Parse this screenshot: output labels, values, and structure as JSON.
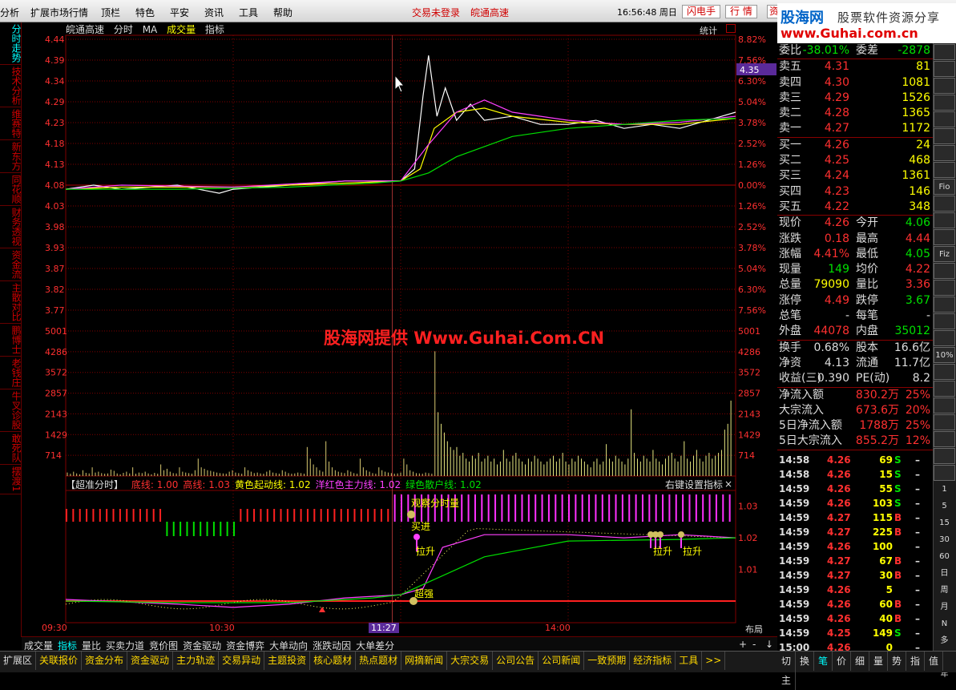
{
  "menu": {
    "items": [
      "分析",
      "扩展市场行情",
      "顶栏",
      "特色",
      "平安",
      "资讯",
      "工具",
      "帮助"
    ],
    "trade_status": "交易未登录",
    "stock_name": "皖通高速",
    "clock": "16:56:48 周日",
    "btn_flash": "闪电手",
    "btn_quote": "行 情",
    "btn_info": "资"
  },
  "logo": {
    "line1": "股海网",
    "line2": "股票软件资源分享",
    "line3": "www.Guhai.com.cn"
  },
  "left_tabs": [
    "分时走势",
    "技术分析",
    "维赛特",
    "新东方",
    "同花顺",
    "财务透视",
    "资金流",
    "主散对比",
    "鹏博士",
    "老钱庄",
    "牛叉诊股",
    "敢死队",
    "摆渡1"
  ],
  "chart_header": {
    "stock": "皖通高速",
    "items": [
      "分时",
      "MA",
      "成交量",
      "指标"
    ],
    "stats": "统计"
  },
  "price_axis": {
    "left": [
      "4.44",
      "4.39",
      "4.34",
      "4.29",
      "4.23",
      "4.18",
      "4.13",
      "4.08",
      "4.03",
      "3.98",
      "3.93",
      "3.87",
      "3.82",
      "3.77"
    ],
    "right": [
      "8.82%",
      "7.56%",
      "6.30%",
      "5.04%",
      "3.78%",
      "2.52%",
      "1.26%",
      "0.00%",
      "1.26%",
      "2.52%",
      "3.78%",
      "5.04%",
      "6.30%",
      "7.56%"
    ],
    "current_tag": "4.35"
  },
  "volume_axis": [
    "5001",
    "4286",
    "3572",
    "2857",
    "2143",
    "1429",
    "714"
  ],
  "indicator": {
    "title": "【超准分时】",
    "params": [
      {
        "label": "底线: 1.00",
        "color": "#ff3030"
      },
      {
        "label": "高线: 1.03",
        "color": "#ff3030"
      },
      {
        "label": "黄色起动线: 1.02",
        "color": "#ffff00"
      },
      {
        "label": "洋红色主力线: 1.02",
        "color": "#ff40ff"
      },
      {
        "label": "绿色散户线: 1.02",
        "color": "#00e000"
      }
    ],
    "settings": "右键设置指标",
    "close": "×",
    "axis": [
      "1.03",
      "1.02",
      "1.01"
    ],
    "labels": {
      "watch": "观察分时量",
      "buy": "买进",
      "lift": "拉升",
      "strong": "超强",
      "lift2": "拉升",
      "lift3": "拉升"
    }
  },
  "watermark": "股海网提供 Www.Guhai.Com.CN",
  "time_axis": {
    "t0": "09:30",
    "t1": "10:30",
    "t2": "11:27",
    "t3": "14:00",
    "layout": "布局"
  },
  "bottom_tabs": [
    "成交量",
    "指标",
    "量比",
    "买卖力道",
    "竞价图",
    "资金驱动",
    "资金博弈",
    "大单动向",
    "涨跌动因",
    "大单差分"
  ],
  "bottom_tabs_active": 1,
  "bottom_controls": [
    "+",
    "-",
    "↓"
  ],
  "status_tabs": [
    "扩展区",
    "关联报价",
    "资金分布",
    "资金驱动",
    "主力轨迹",
    "交易异动",
    "主题投资",
    "核心题材",
    "热点题材",
    "网摘新闻",
    "大宗交易",
    "公司公告",
    "公司新闻",
    "一致预期",
    "经济指标",
    "工具",
    ">>"
  ],
  "right_bottom_tabs": [
    "切",
    "换",
    "笔",
    "价",
    "细",
    "量",
    "势",
    "指",
    "值",
    "主"
  ],
  "order_book": {
    "weibi_label": "委比",
    "weibi": "-38.01%",
    "weicha_label": "委差",
    "weicha": "-2878",
    "asks": [
      {
        "label": "卖五",
        "price": "4.31",
        "vol": "81"
      },
      {
        "label": "卖四",
        "price": "4.30",
        "vol": "1081"
      },
      {
        "label": "卖三",
        "price": "4.29",
        "vol": "1526"
      },
      {
        "label": "卖二",
        "price": "4.28",
        "vol": "1365"
      },
      {
        "label": "卖一",
        "price": "4.27",
        "vol": "1172"
      }
    ],
    "bids": [
      {
        "label": "买一",
        "price": "4.26",
        "vol": "24"
      },
      {
        "label": "买二",
        "price": "4.25",
        "vol": "468"
      },
      {
        "label": "买三",
        "price": "4.24",
        "vol": "1361"
      },
      {
        "label": "买四",
        "price": "4.23",
        "vol": "146"
      },
      {
        "label": "买五",
        "price": "4.22",
        "vol": "348"
      }
    ]
  },
  "quote": [
    {
      "l1": "现价",
      "v1": "4.26",
      "c1": "red",
      "l2": "今开",
      "v2": "4.06",
      "c2": "green"
    },
    {
      "l1": "涨跌",
      "v1": "0.18",
      "c1": "red",
      "l2": "最高",
      "v2": "4.44",
      "c2": "red"
    },
    {
      "l1": "涨幅",
      "v1": "4.41%",
      "c1": "red",
      "l2": "最低",
      "v2": "4.05",
      "c2": "green"
    },
    {
      "l1": "现量",
      "v1": "149",
      "c1": "green",
      "l2": "均价",
      "v2": "4.22",
      "c2": "red"
    },
    {
      "l1": "总量",
      "v1": "79090",
      "c1": "yellow",
      "l2": "量比",
      "v2": "3.36",
      "c2": "red"
    },
    {
      "l1": "涨停",
      "v1": "4.49",
      "c1": "red",
      "l2": "跌停",
      "v2": "3.67",
      "c2": "green"
    },
    {
      "l1": "总笔",
      "v1": "-",
      "c1": "white",
      "l2": "每笔",
      "v2": "-",
      "c2": "white"
    },
    {
      "l1": "外盘",
      "v1": "44078",
      "c1": "red",
      "l2": "内盘",
      "v2": "35012",
      "c2": "green"
    }
  ],
  "quote2": [
    {
      "l1": "换手",
      "v1": "0.68%",
      "c1": "white",
      "l2": "股本",
      "v2": "16.6亿",
      "c2": "white"
    },
    {
      "l1": "净资",
      "v1": "4.13",
      "c1": "white",
      "l2": "流通",
      "v2": "11.7亿",
      "c2": "white"
    },
    {
      "l1": "收益(三)",
      "v1": "0.390",
      "c1": "white",
      "l2": "PE(动)",
      "v2": "8.2",
      "c2": "white"
    }
  ],
  "flows": [
    {
      "label": "净流入额",
      "value": "830.2万",
      "pct": "25%"
    },
    {
      "label": "大宗流入",
      "value": "673.6万",
      "pct": "20%"
    },
    {
      "label": "5日净流入额",
      "value": "1788万",
      "pct": "25%"
    },
    {
      "label": "5日大宗流入",
      "value": "855.2万",
      "pct": "12%"
    }
  ],
  "ticks": [
    {
      "t": "14:58",
      "p": "4.26",
      "v": "69",
      "bs": "S"
    },
    {
      "t": "14:58",
      "p": "4.26",
      "v": "15",
      "bs": "S"
    },
    {
      "t": "14:59",
      "p": "4.26",
      "v": "55",
      "bs": "S"
    },
    {
      "t": "14:59",
      "p": "4.26",
      "v": "103",
      "bs": "S"
    },
    {
      "t": "14:59",
      "p": "4.27",
      "v": "115",
      "bs": "B"
    },
    {
      "t": "14:59",
      "p": "4.27",
      "v": "225",
      "bs": "B"
    },
    {
      "t": "14:59",
      "p": "4.26",
      "v": "100",
      "bs": ""
    },
    {
      "t": "14:59",
      "p": "4.27",
      "v": "67",
      "bs": "B"
    },
    {
      "t": "14:59",
      "p": "4.27",
      "v": "30",
      "bs": "B"
    },
    {
      "t": "14:59",
      "p": "4.26",
      "v": "5",
      "bs": ""
    },
    {
      "t": "14:59",
      "p": "4.26",
      "v": "60",
      "bs": "B"
    },
    {
      "t": "14:59",
      "p": "4.26",
      "v": "40",
      "bs": "B"
    },
    {
      "t": "14:59",
      "p": "4.25",
      "v": "149",
      "bs": "S"
    },
    {
      "t": "15:00",
      "p": "4.26",
      "v": "0",
      "bs": ""
    }
  ],
  "side_buttons": [
    "",
    "",
    "",
    "",
    "",
    "",
    "",
    "",
    "Fio",
    "",
    "",
    "",
    "Fiz",
    "",
    "",
    "",
    "",
    "",
    "10%",
    "",
    "",
    "",
    "",
    "",
    "",
    "",
    "1",
    "5",
    "15",
    "30",
    "60",
    "日",
    "周",
    "月",
    "N",
    "多",
    "季",
    "年"
  ],
  "colors": {
    "up": "#ff3030",
    "down": "#00e000",
    "volume": "#ffff00",
    "magenta": "#ff40ff",
    "grid": "#800000"
  },
  "chart_data": {
    "type": "line",
    "x_range": [
      "09:30",
      "15:00"
    ],
    "price_ylim": [
      3.72,
      4.44
    ],
    "prev_close": 4.08,
    "series": [
      {
        "points": [
          [
            0,
            4.07
          ],
          [
            10,
            4.08
          ],
          [
            20,
            4.07
          ],
          [
            40,
            4.08
          ],
          [
            55,
            4.06
          ],
          [
            60,
            4.07
          ],
          [
            80,
            4.08
          ],
          [
            100,
            4.09
          ],
          [
            120,
            4.09
          ],
          [
            125,
            4.12
          ],
          [
            128,
            4.3
          ],
          [
            130,
            4.4
          ],
          [
            133,
            4.25
          ],
          [
            136,
            4.32
          ],
          [
            140,
            4.24
          ],
          [
            145,
            4.28
          ],
          [
            150,
            4.24
          ],
          [
            160,
            4.25
          ],
          [
            170,
            4.23
          ],
          [
            180,
            4.23
          ],
          [
            190,
            4.24
          ],
          [
            200,
            4.22
          ],
          [
            210,
            4.23
          ],
          [
            220,
            4.22
          ],
          [
            230,
            4.24
          ],
          [
            235,
            4.25
          ],
          [
            240,
            4.26
          ]
        ],
        "color": "#ffffff"
      },
      {
        "points": [
          [
            0,
            4.07
          ],
          [
            20,
            4.075
          ],
          [
            60,
            4.075
          ],
          [
            100,
            4.085
          ],
          [
            120,
            4.09
          ],
          [
            127,
            4.12
          ],
          [
            132,
            4.22
          ],
          [
            140,
            4.26
          ],
          [
            150,
            4.27
          ],
          [
            160,
            4.25
          ],
          [
            180,
            4.235
          ],
          [
            200,
            4.23
          ],
          [
            220,
            4.23
          ],
          [
            240,
            4.245
          ]
        ],
        "color": "#ffff00"
      },
      {
        "points": [
          [
            0,
            4.07
          ],
          [
            20,
            4.08
          ],
          [
            60,
            4.075
          ],
          [
            100,
            4.09
          ],
          [
            120,
            4.09
          ],
          [
            130,
            4.18
          ],
          [
            140,
            4.26
          ],
          [
            150,
            4.29
          ],
          [
            160,
            4.26
          ],
          [
            180,
            4.24
          ],
          [
            200,
            4.23
          ],
          [
            220,
            4.235
          ],
          [
            240,
            4.25
          ]
        ],
        "color": "#ff40ff"
      },
      {
        "points": [
          [
            0,
            4.07
          ],
          [
            40,
            4.07
          ],
          [
            80,
            4.075
          ],
          [
            110,
            4.085
          ],
          [
            120,
            4.09
          ],
          [
            130,
            4.11
          ],
          [
            140,
            4.15
          ],
          [
            160,
            4.2
          ],
          [
            180,
            4.22
          ],
          [
            200,
            4.23
          ],
          [
            220,
            4.24
          ],
          [
            240,
            4.245
          ]
        ],
        "color": "#00e000"
      }
    ],
    "volume_ylim": [
      0,
      5001
    ],
    "volume": [
      120,
      80,
      150,
      90,
      60,
      200,
      110,
      90,
      300,
      120,
      150,
      100,
      80,
      90,
      220,
      180,
      90,
      60,
      110,
      150,
      90,
      300,
      80,
      120,
      100,
      150,
      90,
      60,
      110,
      80,
      400,
      200,
      250,
      150,
      100,
      90,
      300,
      150,
      120,
      100,
      80,
      200,
      600,
      300,
      250,
      200,
      180,
      150,
      120,
      100,
      90,
      80,
      150,
      200,
      120,
      100,
      80,
      300,
      200,
      150,
      100,
      120,
      90,
      80,
      150,
      200,
      120,
      100,
      80,
      200,
      150,
      100,
      80,
      90,
      120,
      100,
      80,
      1000,
      600,
      400,
      300,
      200,
      150,
      1200,
      500,
      300,
      200,
      150,
      120,
      100,
      200,
      150,
      100,
      80,
      600,
      300,
      200,
      150,
      100,
      80,
      300,
      200,
      150,
      120,
      100,
      80,
      90,
      120,
      600,
      400,
      200,
      150,
      100,
      90,
      80,
      120,
      100,
      80,
      4300,
      2200,
      1800,
      1500,
      1200,
      1000,
      900,
      1000,
      700,
      800,
      600,
      500,
      700,
      600,
      800,
      500,
      600,
      700,
      500,
      600,
      400,
      500,
      900,
      600,
      500,
      700,
      800,
      600,
      500,
      400,
      600,
      500,
      700,
      600,
      500,
      400,
      500,
      600,
      700,
      500,
      600,
      800,
      500,
      400,
      600,
      500,
      700,
      600,
      500,
      400,
      300,
      500,
      600,
      400,
      500,
      1100,
      600,
      500,
      700,
      600,
      500,
      400,
      600,
      2300,
      800,
      600,
      500,
      700,
      600,
      500,
      900,
      600,
      500,
      400,
      600,
      700,
      800,
      600,
      500,
      700,
      1200,
      600,
      500,
      700,
      900,
      600,
      500,
      700,
      800,
      600,
      700,
      800,
      900,
      1600,
      1800,
      2600
    ],
    "indicator_ylim": [
      1.0,
      1.035
    ],
    "indicator_series": [
      {
        "points": [
          [
            0,
            1.0005
          ],
          [
            40,
            0.999
          ],
          [
            60,
            0.998
          ],
          [
            80,
            0.999
          ],
          [
            100,
            1.001
          ],
          [
            120,
            1.002
          ],
          [
            128,
            1.004
          ],
          [
            135,
            1.017
          ],
          [
            150,
            1.021
          ],
          [
            180,
            1.021
          ],
          [
            200,
            1.02
          ],
          [
            220,
            1.021
          ],
          [
            240,
            1.02
          ]
        ],
        "color": "#ff40ff"
      },
      {
        "points": [
          [
            0,
            1.0
          ],
          [
            40,
            0.9995
          ],
          [
            80,
            0.9995
          ],
          [
            110,
            1.001
          ],
          [
            120,
            1.002
          ],
          [
            130,
            1.006
          ],
          [
            150,
            1.014
          ],
          [
            180,
            1.019
          ],
          [
            220,
            1.0195
          ],
          [
            240,
            1.02
          ]
        ],
        "color": "#00e000"
      }
    ]
  }
}
